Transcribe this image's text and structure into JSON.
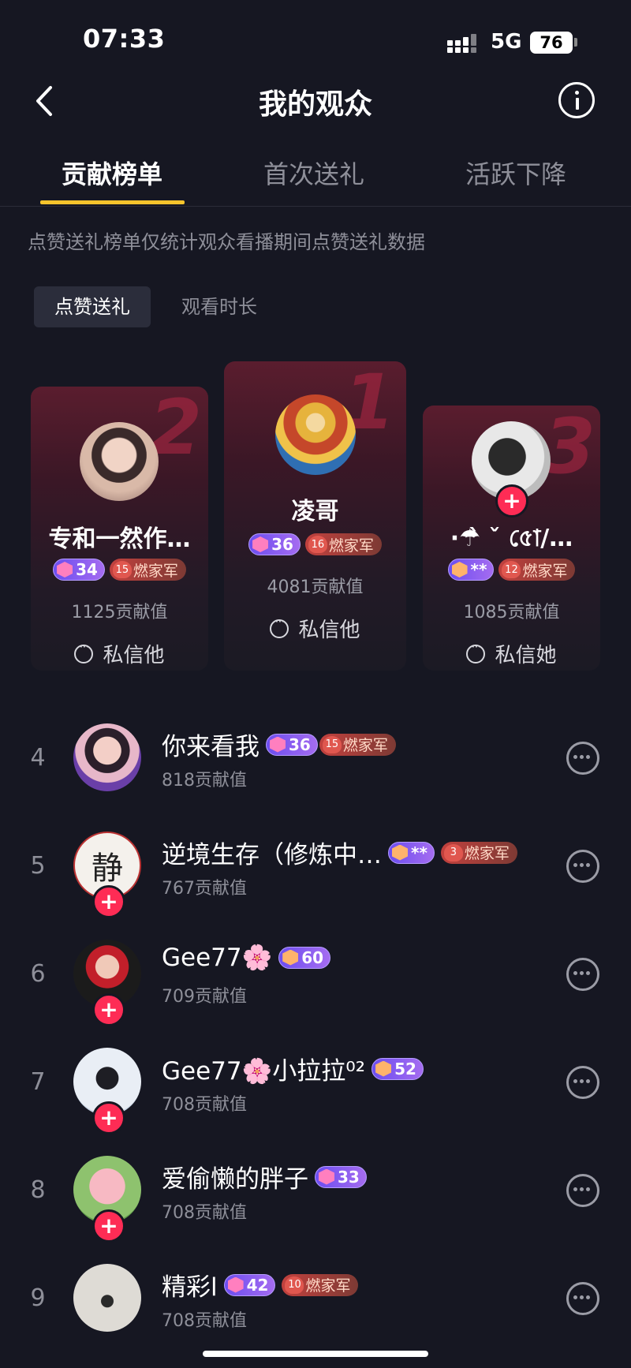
{
  "status": {
    "time": "07:33",
    "network": "5G",
    "battery": "76"
  },
  "nav": {
    "title": "我的观众"
  },
  "tabs": [
    {
      "label": "贡献榜单"
    },
    {
      "label": "首次送礼"
    },
    {
      "label": "活跃下降"
    }
  ],
  "note": "点赞送礼榜单仅统计观众看播期间点赞送礼数据",
  "segments": [
    {
      "label": "点赞送礼"
    },
    {
      "label": "观看时长"
    }
  ],
  "podium": [
    {
      "rank": "2",
      "name": "专和一然作…",
      "level": "34",
      "fan": "燃家军",
      "fan_level": "15",
      "value": "1125贡献值",
      "msg": "私信他"
    },
    {
      "rank": "1",
      "name": "凌哥",
      "level": "36",
      "fan": "燃家军",
      "fan_level": "16",
      "value": "4081贡献值",
      "msg": "私信他"
    },
    {
      "rank": "3",
      "name": "·☂̀ ˇ ৫ো/…",
      "level": "**",
      "fan": "燃家军",
      "fan_level": "12",
      "value": "1085贡献值",
      "msg": "私信她"
    }
  ],
  "list": [
    {
      "rank": "4",
      "name": "你来看我",
      "level": "36",
      "fan": "燃家军",
      "fan_level": "15",
      "value": "818贡献值"
    },
    {
      "rank": "5",
      "name": "逆境生存（修炼中…",
      "level": "**",
      "fan": "燃家军",
      "fan_level": "3",
      "value": "767贡献值",
      "avatar_text": "静"
    },
    {
      "rank": "6",
      "name": "Gee77🌸",
      "level": "60",
      "value": "709贡献值"
    },
    {
      "rank": "7",
      "name": "Gee77🌸小拉拉⁰²",
      "level": "52",
      "value": "708贡献值"
    },
    {
      "rank": "8",
      "name": "爱偷懒的胖子",
      "level": "33",
      "value": "708贡献值"
    },
    {
      "rank": "9",
      "name": "精彩l",
      "level": "42",
      "fan": "燃家军",
      "fan_level": "10",
      "value": "708贡献值"
    }
  ],
  "colors": {
    "background": "#161722",
    "accent_tab": "#f6c42c",
    "follow": "#fe2c55"
  },
  "icons": [
    "back-arrow-icon",
    "info-icon",
    "message-icon",
    "plus-icon",
    "level-badge-icon",
    "fan-heart-icon"
  ]
}
